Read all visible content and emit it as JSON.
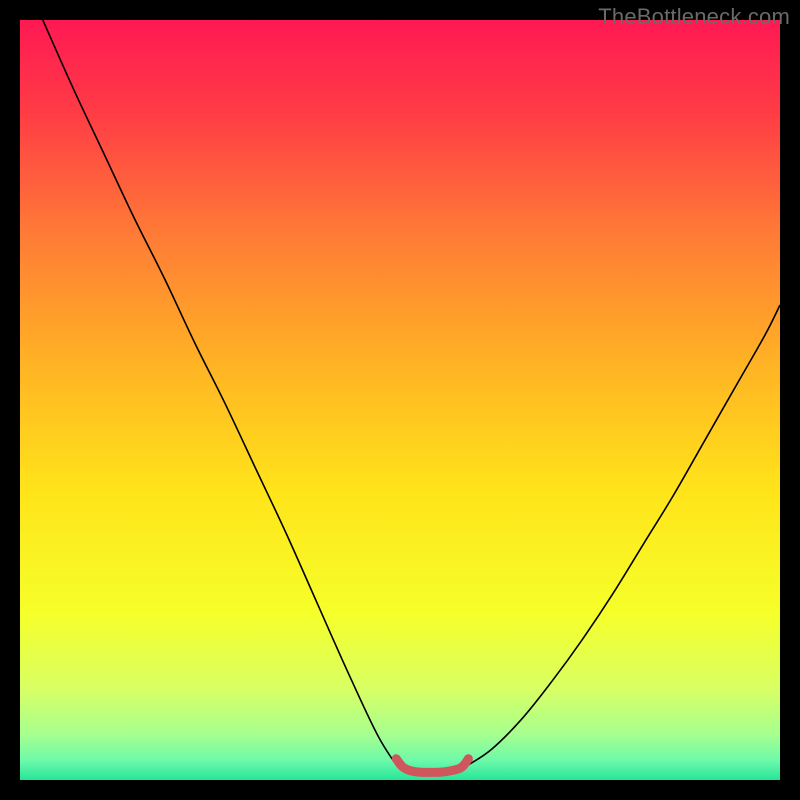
{
  "watermark": "TheBottleneck.com",
  "chart_data": {
    "type": "line",
    "title": "",
    "xlabel": "",
    "ylabel": "",
    "xlim": [
      0,
      1
    ],
    "ylim": [
      0,
      1
    ],
    "grid": false,
    "legend": false,
    "background": {
      "type": "vertical-gradient",
      "stops": [
        {
          "pos": 0.0,
          "color": "#ff1953"
        },
        {
          "pos": 0.12,
          "color": "#ff3b45"
        },
        {
          "pos": 0.28,
          "color": "#ff7a36"
        },
        {
          "pos": 0.45,
          "color": "#ffb224"
        },
        {
          "pos": 0.62,
          "color": "#ffe41a"
        },
        {
          "pos": 0.78,
          "color": "#f6ff2a"
        },
        {
          "pos": 0.88,
          "color": "#d8ff63"
        },
        {
          "pos": 0.94,
          "color": "#a6ff8f"
        },
        {
          "pos": 0.975,
          "color": "#6cf9a9"
        },
        {
          "pos": 1.0,
          "color": "#26e59a"
        }
      ]
    },
    "series": [
      {
        "name": "left-branch",
        "stroke": "#000000",
        "stroke_width": 1.6,
        "x": [
          0.03,
          0.07,
          0.11,
          0.15,
          0.19,
          0.23,
          0.27,
          0.31,
          0.35,
          0.39,
          0.43,
          0.47,
          0.497
        ],
        "y": [
          1.0,
          0.91,
          0.825,
          0.74,
          0.66,
          0.575,
          0.495,
          0.41,
          0.325,
          0.235,
          0.145,
          0.06,
          0.017
        ]
      },
      {
        "name": "right-branch",
        "stroke": "#000000",
        "stroke_width": 1.6,
        "x": [
          0.585,
          0.62,
          0.66,
          0.7,
          0.74,
          0.78,
          0.82,
          0.86,
          0.9,
          0.94,
          0.98,
          1.0
        ],
        "y": [
          0.017,
          0.04,
          0.08,
          0.13,
          0.185,
          0.245,
          0.31,
          0.375,
          0.445,
          0.515,
          0.585,
          0.625
        ]
      },
      {
        "name": "basin-highlight",
        "stroke": "#cf565c",
        "stroke_width": 9,
        "linecap": "round",
        "x": [
          0.495,
          0.505,
          0.52,
          0.54,
          0.56,
          0.58,
          0.59
        ],
        "y": [
          0.028,
          0.016,
          0.011,
          0.01,
          0.011,
          0.016,
          0.028
        ]
      }
    ]
  }
}
